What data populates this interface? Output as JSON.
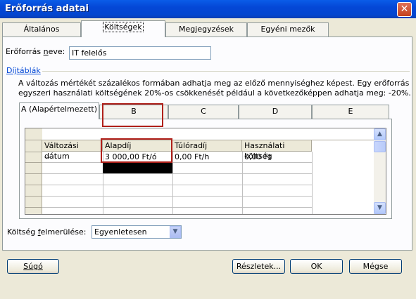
{
  "window": {
    "title": "Erőforrás adatai",
    "close_glyph": "✕"
  },
  "tabs": [
    {
      "label": "Általános"
    },
    {
      "label": "Költségek"
    },
    {
      "label": "Megjegyzések"
    },
    {
      "label": "Egyéni mezők"
    }
  ],
  "resource_name": {
    "label": "Erőforrás neve:",
    "value": "IT felelős"
  },
  "rate_tables": {
    "heading": "Díjtáblák",
    "description_line1": "A változás mértékét százalékos formában adhatja meg az előző mennyiséghez képest. Egy erőforrás",
    "description_line2": "egyszeri használati költségének 20%-os csökkenését például a következőképpen adhatja meg: -20%.",
    "tabs": [
      {
        "label": "A (Alapértelmezett)"
      },
      {
        "label": "B"
      },
      {
        "label": "C"
      },
      {
        "label": "D"
      },
      {
        "label": "E"
      }
    ],
    "columns": [
      "Változási dátum",
      "Alapdíj",
      "Túlóradíj",
      "Használati költség"
    ],
    "rows": [
      {
        "date": "--",
        "standard_rate": "3 000,00 Ft/ó",
        "overtime_rate": "0,00 Ft/h",
        "per_use_cost": "0,00 Ft"
      }
    ]
  },
  "cost_accrual": {
    "label": "Költség felmerülése:",
    "value": "Egyenletesen"
  },
  "buttons": {
    "help": "Súgó",
    "details": "Részletek...",
    "ok": "OK",
    "cancel": "Mégse"
  },
  "icons": {
    "scroll_up": "▲",
    "scroll_down": "▼",
    "dropdown": "▼"
  }
}
